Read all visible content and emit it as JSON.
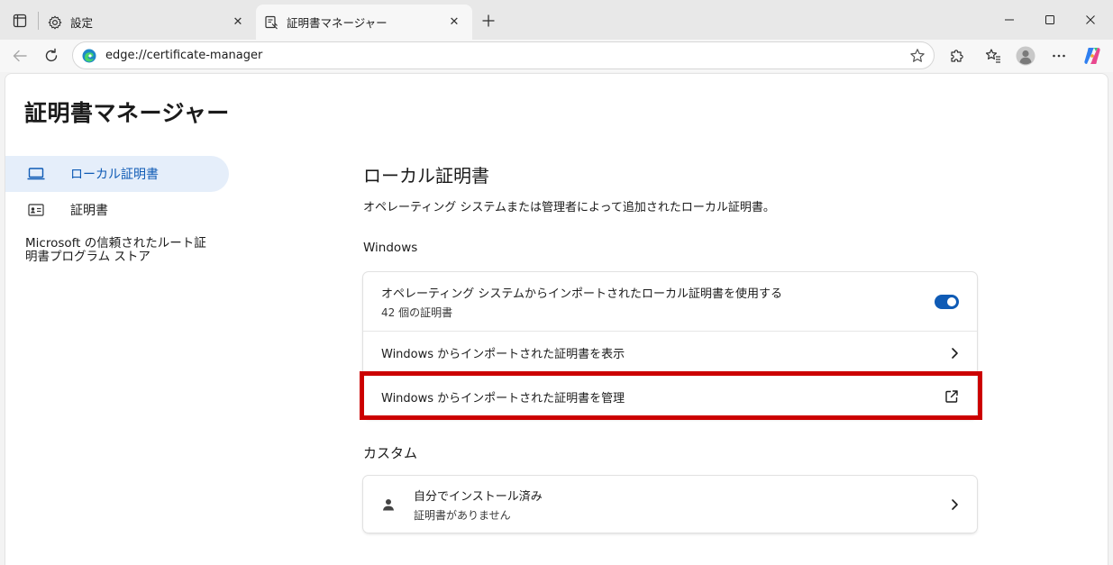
{
  "tabs": [
    {
      "title": "設定",
      "icon": "gear-icon"
    },
    {
      "title": "証明書マネージャー",
      "icon": "certificate-page-icon"
    }
  ],
  "toolbar": {
    "url": "edge://certificate-manager"
  },
  "page": {
    "title": "証明書マネージャー"
  },
  "sidebar": {
    "items": [
      {
        "label": "ローカル証明書",
        "icon": "laptop-icon",
        "selected": true
      },
      {
        "label": "証明書",
        "icon": "id-card-icon",
        "selected": false
      },
      {
        "label": "Microsoft の信頼されたルート証明書プログラム ストア",
        "icon": "",
        "selected": false
      }
    ]
  },
  "main": {
    "section_title": "ローカル証明書",
    "section_desc": "オペレーティング システムまたは管理者によって追加されたローカル証明書。",
    "windows_group": {
      "label": "Windows",
      "rows": [
        {
          "primary": "オペレーティング システムからインポートされたローカル証明書を使用する",
          "secondary": "42 個の証明書",
          "toggle_on": true
        },
        {
          "primary": "Windows からインポートされた証明書を表示"
        },
        {
          "primary": "Windows からインポートされた証明書を管理"
        }
      ]
    },
    "custom_group": {
      "label": "カスタム",
      "rows": [
        {
          "primary": "自分でインストール済み",
          "secondary": "証明書がありません"
        }
      ]
    }
  },
  "colors": {
    "accent": "#0f5bb5",
    "highlight": "#cc0000",
    "selected_bg": "#e5eefa"
  }
}
